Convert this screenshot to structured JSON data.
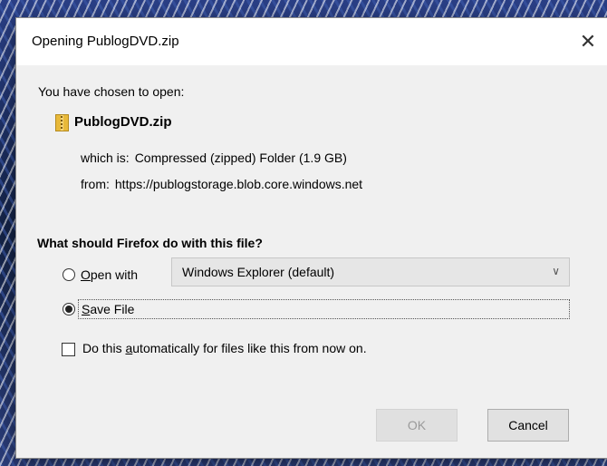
{
  "window": {
    "title": "Opening PublogDVD.zip",
    "close_icon": "close-icon"
  },
  "info": {
    "chosen_label": "You have chosen to open:",
    "file_icon": "zip-archive-icon",
    "filename": "PublogDVD.zip",
    "which_is_label": "which is:",
    "which_is_value": "Compressed (zipped) Folder (1.9 GB)",
    "from_label": "from:",
    "from_value": "https://publogstorage.blob.core.windows.net"
  },
  "options": {
    "question": "What should Firefox do with this file?",
    "open_with": {
      "prefix": "",
      "accel": "O",
      "rest": "pen with",
      "selected": false
    },
    "app_select": {
      "value": "Windows Explorer (default)",
      "chevron_icon": "chevron-down-icon"
    },
    "save_file": {
      "accel": "S",
      "rest": "ave File",
      "selected": true
    },
    "auto": {
      "before": "Do this ",
      "accel": "a",
      "rest": "utomatically for files like this from now on.",
      "checked": false
    }
  },
  "buttons": {
    "ok": "OK",
    "cancel": "Cancel",
    "ok_enabled": false
  }
}
